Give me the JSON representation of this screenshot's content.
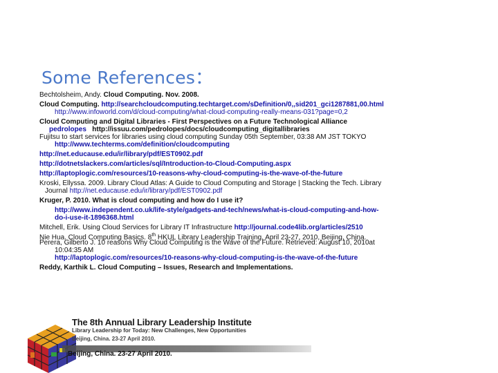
{
  "title": "Some References：",
  "refs": {
    "r1": "Bechtolsheim,  Andy. ",
    "r1b": "Cloud Computing. Nov. 2008.",
    "r2a": "Cloud Computing. ",
    "r2b": "http://searchcloudcomputing.techtarget.com/sDefinition/0,,sid201_gci1287881,00.html",
    "r2c": "http://www.infoworld.com/d/cloud-computing/what-cloud-computing-really-means-031?page=0,2",
    "r3": "Cloud Computing and Digital Libraries - First Perspectives on a Future Technological Alliance",
    "r3a": "pedrolopes",
    "r3b": "http://issuu.com/pedrolopes/docs/cloudcomputing_digitallibraries",
    "r4": "Fujitsu to start services for libraries using cloud computing Sunday 05th September, 03:38 AM JST  TOKYO",
    "r4b": "http://www.techterms.com/definition/cloudcomputing",
    "r5": "http://net.educause.edu/ir/library/pdf/EST0902.pdf",
    "r6": "http://dotnetslackers.com/articles/sql/Introduction-to-Cloud-Computing.aspx",
    "r7": "http://laptoplogic.com/resources/10-reasons-why-cloud-computing-is-the-wave-of-the-future",
    "r8": "Kroski,  Ellyssa. 2009. Library Cloud Atlas: A Guide to Cloud Computing and Storage | Stacking the Tech. Library",
    "r8a": "Journal  ",
    "r8b": "http://net.educause.edu/ir/library/pdf/EST0902.pdf",
    "r9": " Kruger, P. 2010. What is cloud computing and how do I use it?",
    "r9a": "http://www.independent.co.uk/life-style/gadgets-and-tech/news/what-is-cloud-computing-and-how-",
    "r9b": "do-i-use-it-1896368.html",
    "r10a": "Mitchell, Erik.  Using Cloud Services for Library IT Infrastructure ",
    "r10b": "http://journal.code4lib.org/articles/2510",
    "r11a": "Nie Hua.  Cloud Computing Basics.  8",
    "r11sup": "th",
    "r11b": " HKUL Library Leadership Training, April 23-27, 2010, Beijing, China.",
    "r12": "Perera, Gilberto J.  10 reasons Why Cloud Computing is the Wave of the Future. Retrieved: August 10, 2010at",
    "r12a": "10:04:35 AM",
    "r12b": "http://laptoplogic.com/resources/10-reasons-why-cloud-computing-is-the-wave-of-the-future",
    "r13a": "Reddy,  Karthik L. ",
    "r13b": "Cloud Computing – Issues, Research and Implementations."
  },
  "banner": {
    "title": "The 8th Annual Library Leadership Institute",
    "subtitle": "Library Leadership for Today: New Challenges, New Opportunities",
    "date": "Beijing, China. 23-27 April 2010.",
    "date2": "Beijing, China. 23-27 April 2010."
  },
  "colors": {
    "title": "#4a78c9",
    "link": "#1414a8"
  }
}
